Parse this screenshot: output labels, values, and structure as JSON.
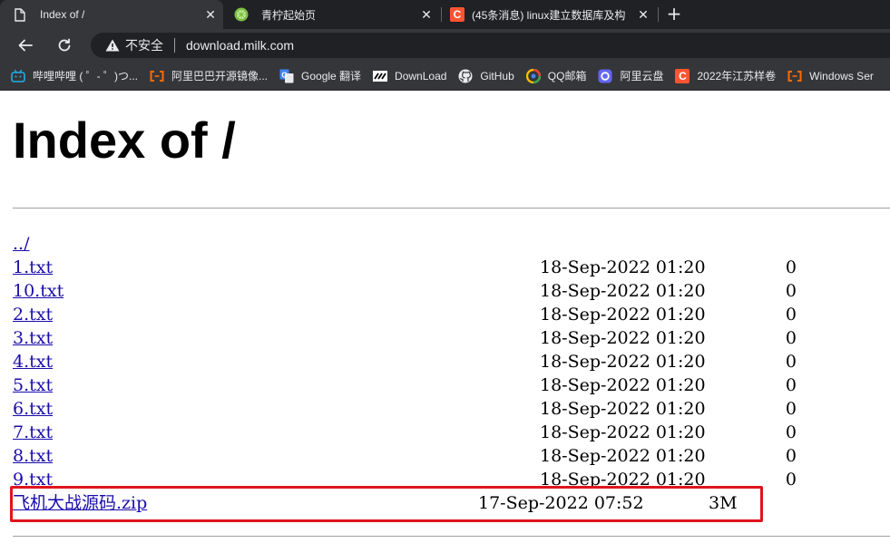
{
  "colors": {
    "tab_bar": "#202124",
    "toolbar": "#35363a",
    "link": "#1a0dab",
    "highlight_border": "#e0141e"
  },
  "tabs": [
    {
      "title": "Index of /",
      "icon": "page-icon",
      "active": true
    },
    {
      "title": "青柠起始页",
      "icon": "lime-icon",
      "active": false
    },
    {
      "title": "(45条消息) linux建立数据库及构",
      "icon": "csdn-icon",
      "active": false
    }
  ],
  "toolbar": {
    "security_label": "不安全",
    "url": "download.milk.com"
  },
  "bookmarks": [
    {
      "label": "哔哩哔哩 ( ゜- ゜)つ...",
      "icon": "bilibili-icon"
    },
    {
      "label": "阿里巴巴开源镜像...",
      "icon": "aliyun-bracket-icon"
    },
    {
      "label": "Google 翻译",
      "icon": "google-translate-icon"
    },
    {
      "label": "DownLoad",
      "icon": "download-site-icon"
    },
    {
      "label": "GitHub",
      "icon": "github-icon"
    },
    {
      "label": "QQ邮箱",
      "icon": "qq-mail-icon"
    },
    {
      "label": "阿里云盘",
      "icon": "aliyun-drive-icon"
    },
    {
      "label": "2022年江苏样卷",
      "icon": "csdn-icon"
    },
    {
      "label": "Windows Ser",
      "icon": "aliyun-bracket-icon"
    }
  ],
  "page": {
    "heading": "Index of /",
    "parent_link": "../",
    "files": [
      {
        "name": "1.txt",
        "date": "18-Sep-2022 01:20",
        "size": "0"
      },
      {
        "name": "10.txt",
        "date": "18-Sep-2022 01:20",
        "size": "0"
      },
      {
        "name": "2.txt",
        "date": "18-Sep-2022 01:20",
        "size": "0"
      },
      {
        "name": "3.txt",
        "date": "18-Sep-2022 01:20",
        "size": "0"
      },
      {
        "name": "4.txt",
        "date": "18-Sep-2022 01:20",
        "size": "0"
      },
      {
        "name": "5.txt",
        "date": "18-Sep-2022 01:20",
        "size": "0"
      },
      {
        "name": "6.txt",
        "date": "18-Sep-2022 01:20",
        "size": "0"
      },
      {
        "name": "7.txt",
        "date": "18-Sep-2022 01:20",
        "size": "0"
      },
      {
        "name": "8.txt",
        "date": "18-Sep-2022 01:20",
        "size": "0"
      },
      {
        "name": "9.txt",
        "date": "18-Sep-2022 01:20",
        "size": "0"
      },
      {
        "name": "飞机大战源码.zip",
        "date": "17-Sep-2022 07:52",
        "size": "3M",
        "highlighted": true
      }
    ]
  }
}
